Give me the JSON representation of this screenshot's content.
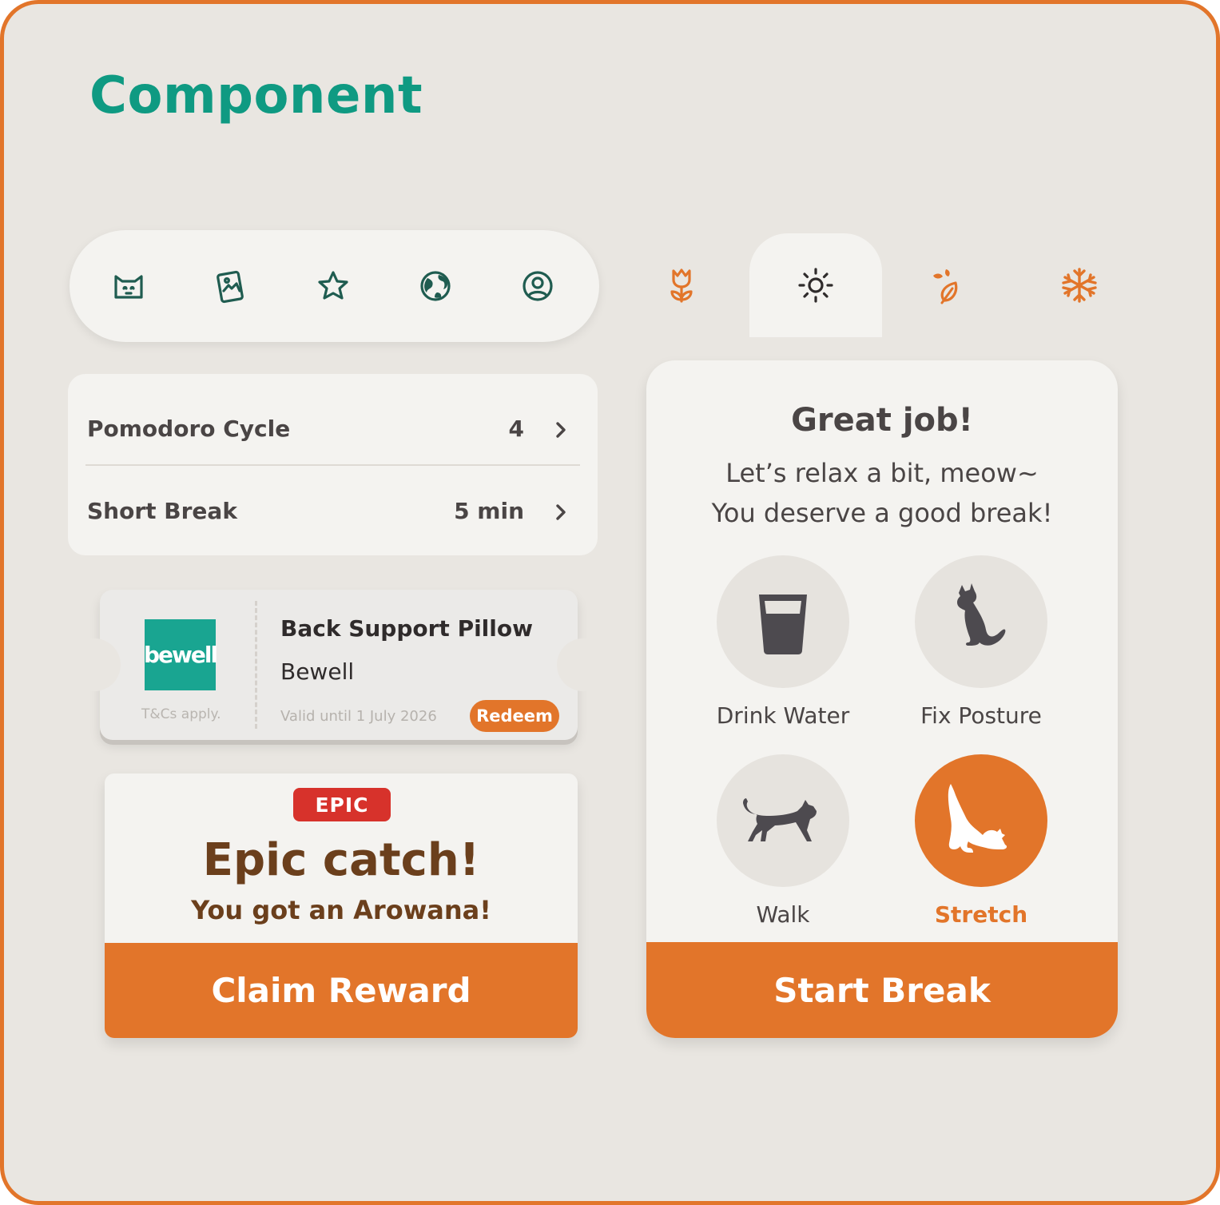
{
  "page": {
    "title": "Component"
  },
  "nav": {
    "icons": [
      "cat-icon",
      "photo-card-icon",
      "star-icon",
      "globe-icon",
      "profile-icon"
    ]
  },
  "seasons": {
    "tabs": [
      "tulip-icon",
      "sun-icon",
      "leaves-icon",
      "snowflake-icon"
    ],
    "active": "sun-icon"
  },
  "settings": {
    "rows": [
      {
        "label": "Pomodoro Cycle",
        "value": "4"
      },
      {
        "label": "Short Break",
        "value": "5 min"
      }
    ]
  },
  "coupon": {
    "logo_text": "bewell",
    "tcs": "T&Cs apply.",
    "title": "Back Support Pillow",
    "brand": "Bewell",
    "valid": "Valid until 1 July 2026",
    "redeem_label": "Redeem"
  },
  "catch": {
    "rarity": "EPIC",
    "title": "Epic catch!",
    "subtitle": "You got an Arowana!",
    "claim_label": "Claim Reward"
  },
  "break": {
    "title": "Great job!",
    "line1": "Let’s relax a bit, meow~",
    "line2": "You deserve a good break!",
    "activities": [
      {
        "label": "Drink Water",
        "icon": "water-glass-icon",
        "selected": false
      },
      {
        "label": "Fix Posture",
        "icon": "sitting-cat-icon",
        "selected": false
      },
      {
        "label": "Walk",
        "icon": "walking-cat-icon",
        "selected": false
      },
      {
        "label": "Stretch",
        "icon": "stretching-cat-icon",
        "selected": true
      }
    ],
    "start_label": "Start Break"
  },
  "colors": {
    "accent": "#e2752a",
    "teal": "#0f9a82",
    "nav_icon": "#1f5c50",
    "brown": "#6b3f1c",
    "epic_red": "#d7322b",
    "background": "#e9e6e1",
    "card": "#f4f3f0"
  }
}
